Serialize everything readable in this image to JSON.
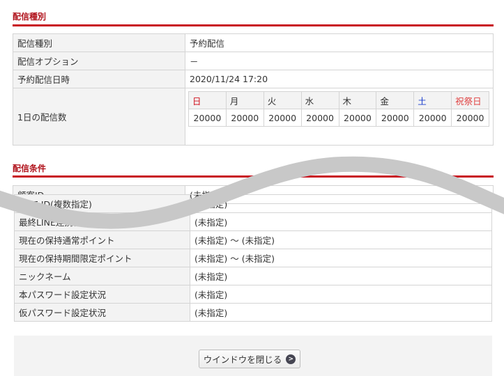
{
  "section1": {
    "title": "配信種別",
    "rows": [
      {
        "label": "配信種別",
        "value": "予約配信"
      },
      {
        "label": "配信オプション",
        "value": "－"
      },
      {
        "label": "予約配信日時",
        "value": "2020/11/24 17:20"
      },
      {
        "label": "1日の配信数"
      }
    ],
    "days": [
      {
        "name": "日",
        "count": "20000",
        "color": "#d0101c"
      },
      {
        "name": "月",
        "count": "20000"
      },
      {
        "name": "火",
        "count": "20000"
      },
      {
        "name": "水",
        "count": "20000"
      },
      {
        "name": "木",
        "count": "20000"
      },
      {
        "name": "金",
        "count": "20000"
      },
      {
        "name": "土",
        "count": "20000",
        "color": "#1a3ccc"
      },
      {
        "name": "祝祭日",
        "count": "20000",
        "color": "#e04040"
      }
    ]
  },
  "section2": {
    "title": "配信条件",
    "first": {
      "label": "顧客ID",
      "value": "(未指定)"
    },
    "rows": [
      {
        "label": "LINE ID(複数指定)",
        "value": "(未指定)"
      },
      {
        "label": "最終LINE連携日時",
        "value": "(未指定)"
      },
      {
        "label": "現在の保持通常ポイント",
        "value": "(未指定) ～ (未指定)"
      },
      {
        "label": "現在の保持期間限定ポイント",
        "value": "(未指定) ～ (未指定)"
      },
      {
        "label": "ニックネーム",
        "value": "(未指定)"
      },
      {
        "label": "本パスワード設定状況",
        "value": "(未指定)"
      },
      {
        "label": "仮パスワード設定状況",
        "value": "(未指定)"
      }
    ]
  },
  "footer": {
    "close_label": "ウインドウを閉じる"
  },
  "overlay_color": "#c8c8c8"
}
